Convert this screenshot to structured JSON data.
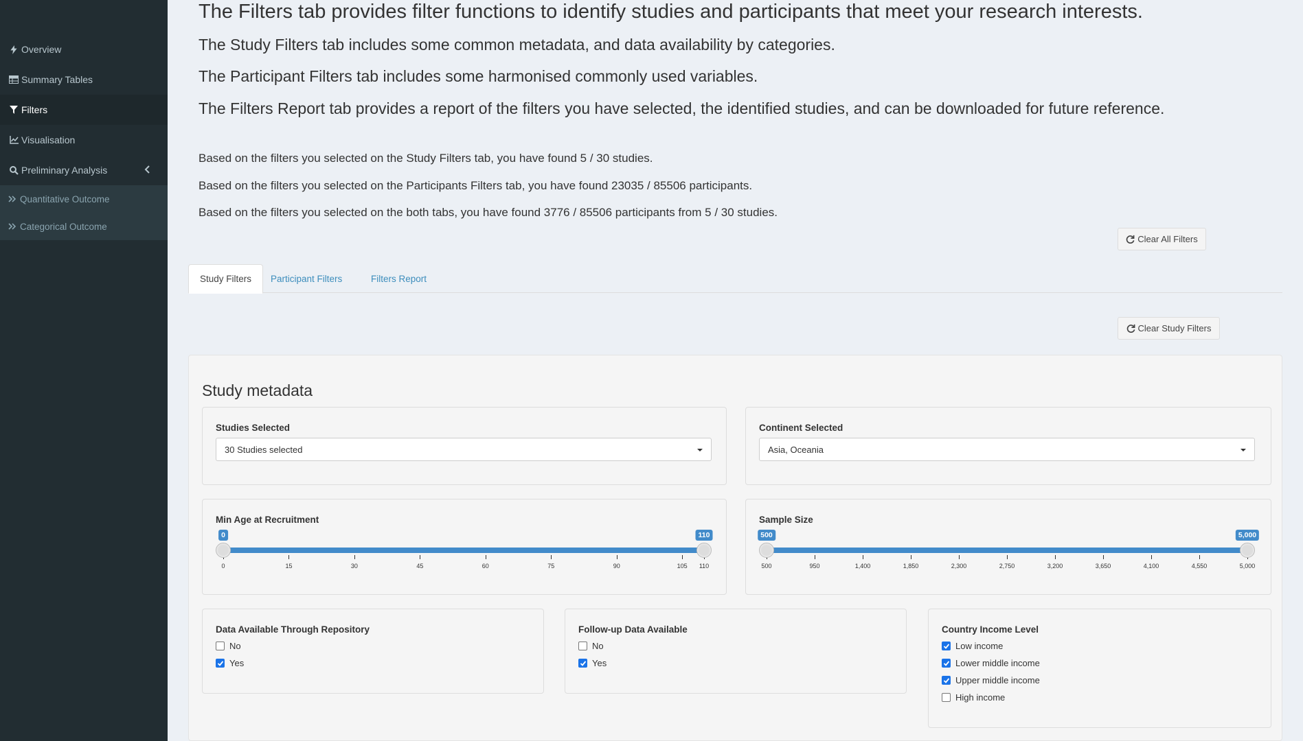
{
  "sidebar": {
    "items": [
      {
        "label": "Overview",
        "icon": "bolt-icon"
      },
      {
        "label": "Summary Tables",
        "icon": "table-icon"
      },
      {
        "label": "Filters",
        "icon": "filter-icon"
      },
      {
        "label": "Visualisation",
        "icon": "line-chart-icon"
      },
      {
        "label": "Preliminary Analysis",
        "icon": "search-icon"
      }
    ],
    "subitems": [
      {
        "label": "Quantitative Outcome",
        "icon": "double-chevron-right-icon"
      },
      {
        "label": "Categorical Outcome",
        "icon": "double-chevron-right-icon"
      }
    ]
  },
  "intro": {
    "lead": "The Filters tab provides filter functions to identify studies and participants that meet your research interests.",
    "line1": "The Study Filters tab includes some common metadata, and data availability by categories.",
    "line2": "The Participant Filters tab includes some harmonised commonly used variables.",
    "line3": "The Filters Report tab provides a report of the filters you have selected, the identified studies, and can be downloaded for future reference."
  },
  "found": {
    "study": "Based on the filters you selected on the Study Filters tab, you have found 5 / 30 studies.",
    "participants": "Based on the filters you selected on the Participants Filters tab, you have found 23035 / 85506 participants.",
    "both": "Based on the filters you selected on the both tabs, you have found 3776 / 85506 participants from 5 / 30 studies."
  },
  "buttons": {
    "clear_all": "Clear All Filters",
    "clear_study": "Clear Study Filters"
  },
  "tabs": [
    "Study Filters",
    "Participant Filters",
    "Filters Report"
  ],
  "study_metadata": {
    "title": "Study metadata",
    "studies_selected": {
      "label": "Studies Selected",
      "value": "30 Studies selected"
    },
    "continent_selected": {
      "label": "Continent Selected",
      "value": "Asia, Oceania"
    },
    "min_age": {
      "label": "Min Age at Recruitment",
      "min": 0,
      "max": 110,
      "from": 0,
      "to": 110,
      "from_label": "0",
      "to_label": "110",
      "ticks": [
        "0",
        "15",
        "30",
        "45",
        "60",
        "75",
        "90",
        "105",
        "110"
      ],
      "tick_values": [
        0,
        15,
        30,
        45,
        60,
        75,
        90,
        105,
        110
      ]
    },
    "sample_size": {
      "label": "Sample Size",
      "min": 500,
      "max": 5000,
      "from": 500,
      "to": 5000,
      "from_label": "500",
      "to_label": "5,000",
      "ticks": [
        "500",
        "950",
        "1,400",
        "1,850",
        "2,300",
        "2,750",
        "3,200",
        "3,650",
        "4,100",
        "4,550",
        "5,000"
      ],
      "tick_values": [
        500,
        950,
        1400,
        1850,
        2300,
        2750,
        3200,
        3650,
        4100,
        4550,
        5000
      ]
    },
    "repository": {
      "label": "Data Available Through Repository",
      "options": [
        {
          "label": "No",
          "checked": false
        },
        {
          "label": "Yes",
          "checked": true
        }
      ]
    },
    "followup": {
      "label": "Follow-up Data Available",
      "options": [
        {
          "label": "No",
          "checked": false
        },
        {
          "label": "Yes",
          "checked": true
        }
      ]
    },
    "income": {
      "label": "Country Income Level",
      "options": [
        {
          "label": "Low income",
          "checked": true
        },
        {
          "label": "Lower middle income",
          "checked": true
        },
        {
          "label": "Upper middle income",
          "checked": true
        },
        {
          "label": "High income",
          "checked": false
        }
      ]
    }
  }
}
